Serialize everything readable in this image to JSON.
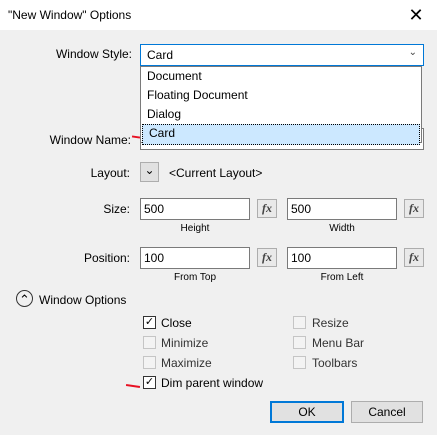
{
  "window": {
    "title": "\"New Window\" Options",
    "close_glyph": "✕"
  },
  "labels": {
    "window_style": "Window Style:",
    "window_name": "Window Name:",
    "layout": "Layout:",
    "size": "Size:",
    "position": "Position:"
  },
  "window_style": {
    "value": "Card",
    "options": [
      "Document",
      "Floating Document",
      "Dialog",
      "Card"
    ],
    "selected_index": 3
  },
  "layout": {
    "button_glyph": "⌄",
    "value": "<Current Layout>"
  },
  "size": {
    "height_value": "500",
    "height_label": "Height",
    "width_value": "500",
    "width_label": "Width"
  },
  "position": {
    "top_value": "100",
    "top_label": "From Top",
    "left_value": "100",
    "left_label": "From Left"
  },
  "fx_label": "fx",
  "window_options": {
    "toggle_glyph": "⌃",
    "label": "Window Options",
    "checkboxes": [
      {
        "label": "Close",
        "checked": true,
        "enabled": true
      },
      {
        "label": "Minimize",
        "checked": false,
        "enabled": false
      },
      {
        "label": "Maximize",
        "checked": false,
        "enabled": false
      },
      {
        "label": "Dim parent window",
        "checked": true,
        "enabled": true
      },
      {
        "label": "Resize",
        "checked": false,
        "enabled": false
      },
      {
        "label": "Menu Bar",
        "checked": false,
        "enabled": false
      },
      {
        "label": "Toolbars",
        "checked": false,
        "enabled": false
      }
    ]
  },
  "buttons": {
    "ok": "OK",
    "cancel": "Cancel"
  },
  "colors": {
    "accent": "#0078d7",
    "dropdown_selected": "#cce8ff",
    "annotation_red": "#e81123"
  }
}
